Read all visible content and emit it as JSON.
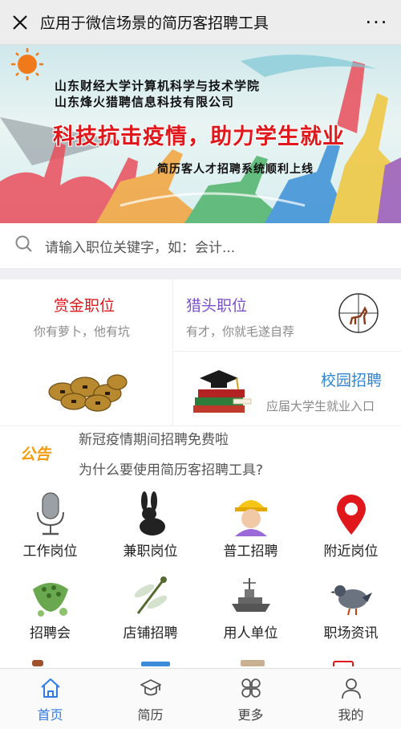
{
  "header": {
    "title": "应用于微信场景的简历客招聘工具",
    "close_icon": "close-icon",
    "more_icon": "more-icon",
    "more_label": "···"
  },
  "banner": {
    "line1": "山东财经大学计算机科学与技术学院",
    "line2": "山东烽火猎聘信息科技有限公司",
    "slogan": "科技抗击疫情，助力学生就业",
    "sub": "简历客人才招聘系统顺利上线"
  },
  "search": {
    "placeholder": "请输入职位关键字，如：会计..."
  },
  "categories": {
    "bounty": {
      "title": "赏金职位",
      "desc": "你有萝卜，他有坑",
      "color": "#e0171b"
    },
    "headhunter": {
      "title": "猎头职位",
      "desc": "有才，你就毛遂自荐",
      "color": "#7b52c8"
    },
    "campus": {
      "title": "校园招聘",
      "desc": "应届大学生就业入口",
      "color": "#2f86d6"
    }
  },
  "notice": {
    "badge": "公告",
    "items": [
      "新冠疫情期间招聘免费啦",
      "为什么要使用简历客招聘工具?"
    ]
  },
  "grid": [
    {
      "label": "工作岗位",
      "icon": "microphone-icon"
    },
    {
      "label": "兼职岗位",
      "icon": "rabbit-icon"
    },
    {
      "label": "普工招聘",
      "icon": "worker-helmet-icon"
    },
    {
      "label": "附近岗位",
      "icon": "location-pin-icon"
    },
    {
      "label": "招聘会",
      "icon": "lotus-pod-icon"
    },
    {
      "label": "店铺招聘",
      "icon": "dragonfly-icon"
    },
    {
      "label": "用人单位",
      "icon": "warship-icon"
    },
    {
      "label": "职场资讯",
      "icon": "pigeon-icon"
    }
  ],
  "tabbar": [
    {
      "label": "首页",
      "icon": "home-icon",
      "active": true
    },
    {
      "label": "简历",
      "icon": "graduation-cap-icon",
      "active": false
    },
    {
      "label": "更多",
      "icon": "clover-grid-icon",
      "active": false
    },
    {
      "label": "我的",
      "icon": "user-icon",
      "active": false
    }
  ],
  "colors": {
    "accent": "#2f7be5",
    "red": "#e0171b",
    "purple": "#7b52c8"
  }
}
